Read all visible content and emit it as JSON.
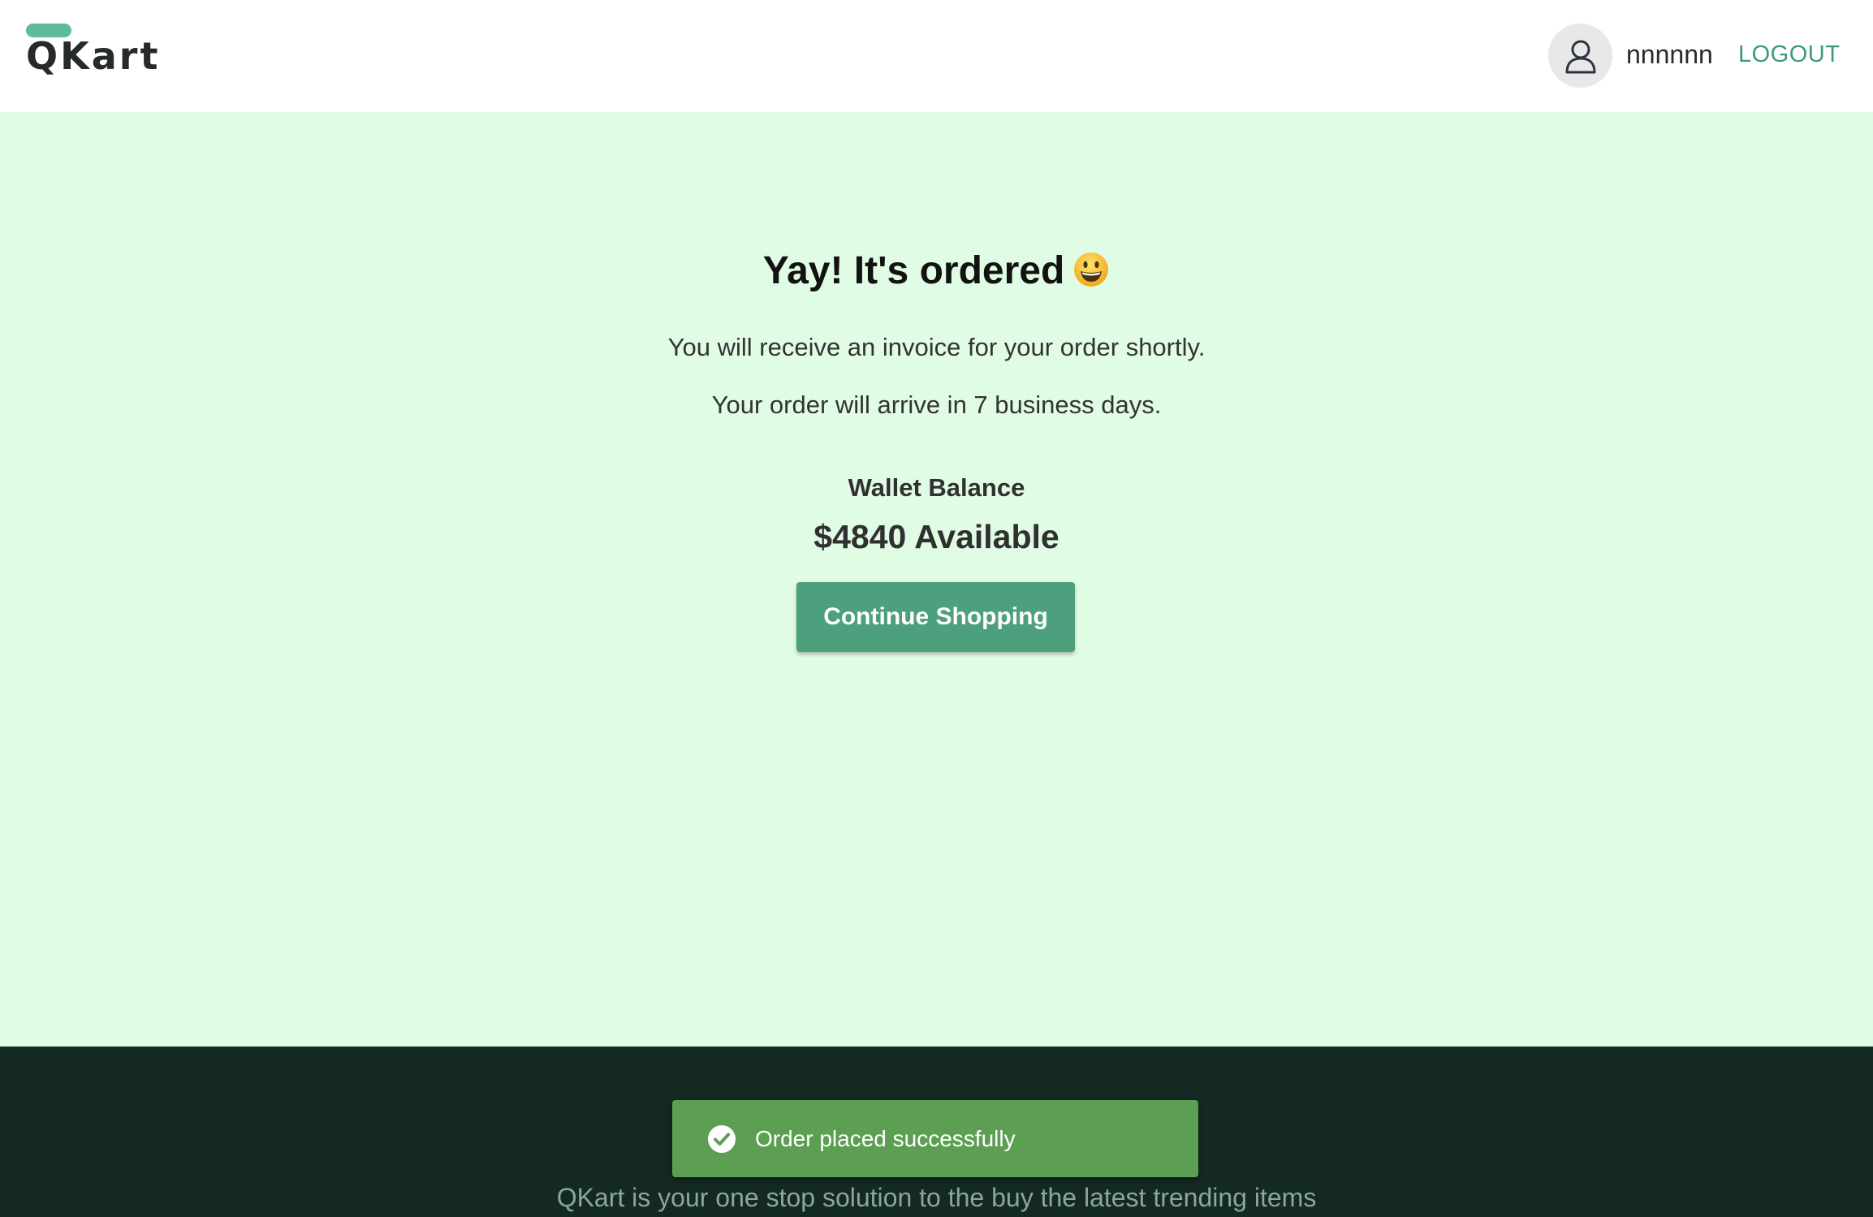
{
  "header": {
    "logo_text": "QKart",
    "username": "nnnnnn",
    "logout_label": "LOGOUT"
  },
  "main": {
    "title": "Yay! It's ordered",
    "title_emoji": "smiling-face-icon",
    "invoice_message": "You will receive an invoice for your order shortly.",
    "delivery_message": "Your order will arrive in 7 business days.",
    "wallet_label": "Wallet Balance",
    "wallet_amount": "$4840 Available",
    "continue_label": "Continue Shopping"
  },
  "toast": {
    "message": "Order placed successfully",
    "icon": "check-circle-icon"
  },
  "footer": {
    "tagline": "QKart is your one stop solution to the buy the latest trending items"
  },
  "colors": {
    "brand": "#5fbb9c",
    "page_background": "#e1fce5",
    "button": "#4da07d",
    "link": "#3a9a7b",
    "footer": "#132922",
    "toast": "#5c9f52"
  }
}
